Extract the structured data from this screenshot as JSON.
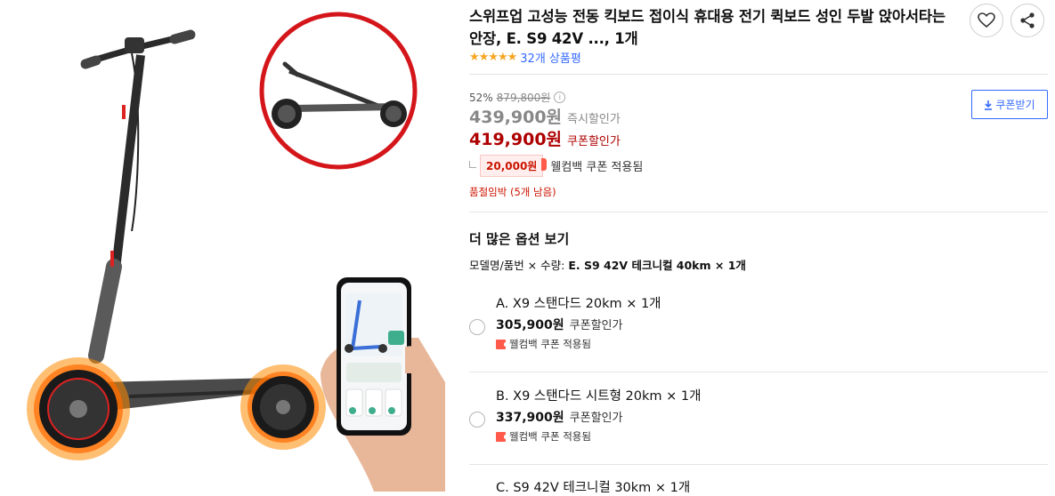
{
  "product": {
    "title": "스위프업 고성능 전동 킥보드 접이식 휴대용 전기 퀵보드 성인 두발 앉아서타는 안장, E. S9 42V ..., 1개",
    "stars": "★★★★★",
    "review_count": "32개 상품평",
    "rating": 5
  },
  "price": {
    "discount_rate": "52%",
    "original_price": "879,800원",
    "instant_price": "439,900원",
    "instant_label": "즉시할인가",
    "coupon_price": "419,900원",
    "coupon_label": "쿠폰할인가",
    "cashback_amount": "20,000원",
    "cashback_label": "웰컴백 쿠폰 적용됨",
    "stock_notice": "품절임박 (5개 남음)"
  },
  "coupon_button": {
    "label": "쿠폰받기"
  },
  "options": {
    "heading": "더 많은 옵션 보기",
    "selected_prefix": "모델명/품번 × 수량:",
    "selected_value": "E. S9 42V 테크니컬 40km × 1개",
    "items": [
      {
        "name": "A. X9 스탠다드 20km × 1개",
        "price": "305,900원",
        "price_label": "쿠폰할인가",
        "cashback": "웰컴백 쿠폰 적용됨"
      },
      {
        "name": "B. X9 스탠다드 시트형 20km × 1개",
        "price": "337,900원",
        "price_label": "쿠폰할인가",
        "cashback": "웰컴백 쿠폰 적용됨"
      },
      {
        "name": "C. S9 42V 테크니컬 30km × 1개"
      }
    ]
  },
  "icons": {
    "wishlist": "heart-icon",
    "share": "share-icon",
    "coupon": "download-icon",
    "info": "info-icon"
  },
  "colors": {
    "accent_blue": "#346aff",
    "sale_red": "#ae0000",
    "star": "#f5a623"
  }
}
